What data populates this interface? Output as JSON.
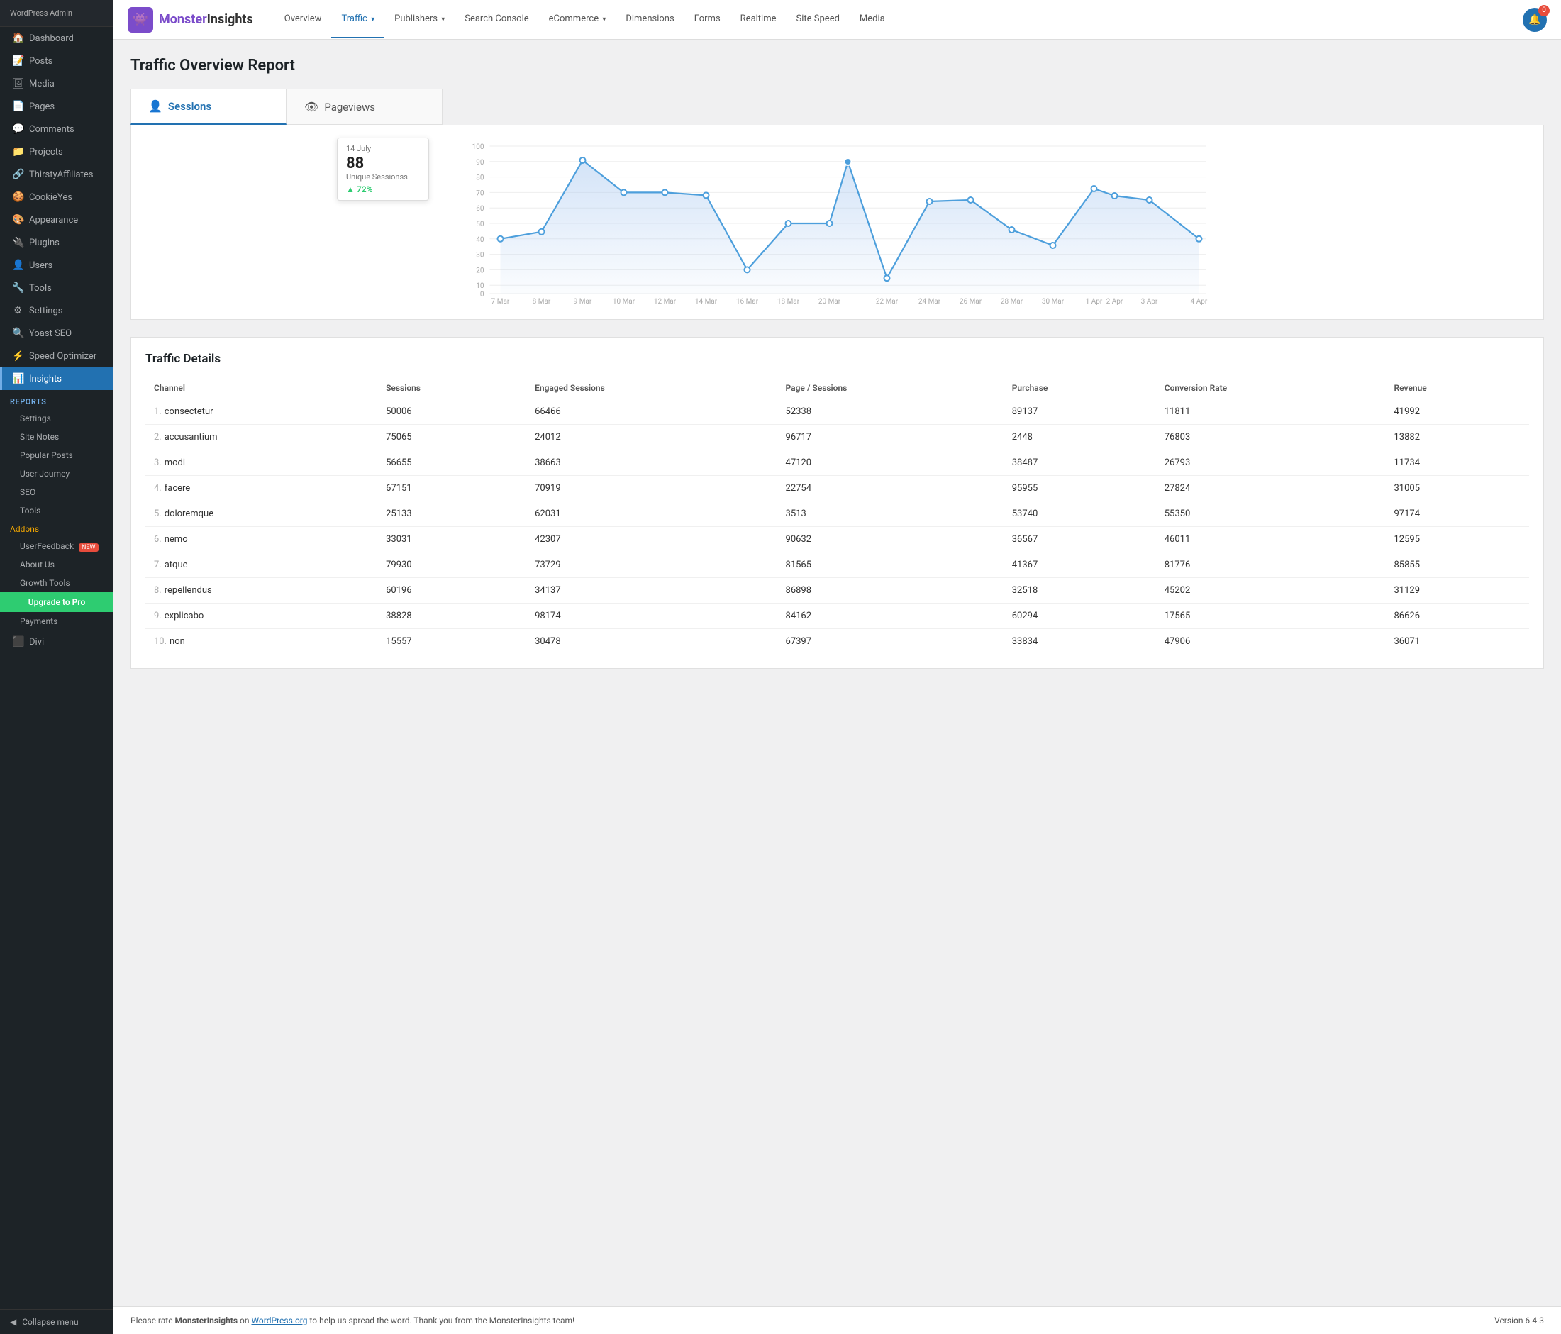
{
  "sidebar": {
    "menu_items": [
      {
        "id": "dashboard",
        "label": "Dashboard",
        "icon": "🏠"
      },
      {
        "id": "posts",
        "label": "Posts",
        "icon": "📝"
      },
      {
        "id": "media",
        "label": "Media",
        "icon": "🖼"
      },
      {
        "id": "pages",
        "label": "Pages",
        "icon": "📄"
      },
      {
        "id": "comments",
        "label": "Comments",
        "icon": "💬"
      },
      {
        "id": "projects",
        "label": "Projects",
        "icon": "📁"
      },
      {
        "id": "thirstyaffiliates",
        "label": "ThirstyAffiliates",
        "icon": "🔗"
      },
      {
        "id": "cookieyes",
        "label": "CookieYes",
        "icon": "🍪"
      },
      {
        "id": "appearance",
        "label": "Appearance",
        "icon": "🎨"
      },
      {
        "id": "plugins",
        "label": "Plugins",
        "icon": "🔌"
      },
      {
        "id": "users",
        "label": "Users",
        "icon": "👤"
      },
      {
        "id": "tools",
        "label": "Tools",
        "icon": "🔧"
      },
      {
        "id": "settings",
        "label": "Settings",
        "icon": "⚙"
      },
      {
        "id": "yoast",
        "label": "Yoast SEO",
        "icon": "🔍"
      },
      {
        "id": "speed",
        "label": "Speed Optimizer",
        "icon": "⚡"
      },
      {
        "id": "insights",
        "label": "Insights",
        "icon": "📊"
      }
    ],
    "reports_section": "Reports",
    "reports_items": [
      {
        "id": "settings",
        "label": "Settings"
      },
      {
        "id": "site-notes",
        "label": "Site Notes"
      },
      {
        "id": "popular-posts",
        "label": "Popular Posts"
      },
      {
        "id": "user-journey",
        "label": "User Journey"
      },
      {
        "id": "seo",
        "label": "SEO"
      },
      {
        "id": "tools",
        "label": "Tools"
      }
    ],
    "addons_label": "Addons",
    "addons_items": [
      {
        "id": "userfeedback",
        "label": "UserFeedback",
        "badge": "NEW"
      },
      {
        "id": "about-us",
        "label": "About Us"
      },
      {
        "id": "growth-tools",
        "label": "Growth Tools"
      }
    ],
    "upgrade_label": "Upgrade to Pro",
    "payments_label": "Payments",
    "divi_label": "Divi",
    "collapse_label": "Collapse menu"
  },
  "topnav": {
    "logo_text_monster": "Monster",
    "logo_text_insights": "Insights",
    "tabs": [
      {
        "id": "overview",
        "label": "Overview",
        "active": false
      },
      {
        "id": "traffic",
        "label": "Traffic",
        "active": true,
        "has_caret": true
      },
      {
        "id": "publishers",
        "label": "Publishers",
        "active": false,
        "has_caret": true
      },
      {
        "id": "search-console",
        "label": "Search Console",
        "active": false
      },
      {
        "id": "ecommerce",
        "label": "eCommerce",
        "active": false,
        "has_caret": true
      },
      {
        "id": "dimensions",
        "label": "Dimensions",
        "active": false
      },
      {
        "id": "forms",
        "label": "Forms",
        "active": false
      },
      {
        "id": "realtime",
        "label": "Realtime",
        "active": false
      },
      {
        "id": "site-speed",
        "label": "Site Speed",
        "active": false
      },
      {
        "id": "media",
        "label": "Media",
        "active": false
      }
    ],
    "notification_count": "0"
  },
  "report": {
    "title": "Traffic Overview Report",
    "metric_tabs": [
      {
        "id": "sessions",
        "label": "Sessions",
        "active": true,
        "icon": "👤"
      },
      {
        "id": "pageviews",
        "label": "Pageviews",
        "active": false,
        "icon": "👁"
      }
    ]
  },
  "chart": {
    "tooltip": {
      "date": "14 July",
      "value": "88",
      "label": "Unique Sessionss",
      "change": "72%"
    },
    "y_labels": [
      "100",
      "90",
      "80",
      "70",
      "60",
      "50",
      "40",
      "30",
      "20",
      "10",
      "0"
    ],
    "x_labels": [
      "7 Mar",
      "8 Mar",
      "9 Mar",
      "10 Mar",
      "12 Mar",
      "14 Mar",
      "16 Mar",
      "18 Mar",
      "20 Mar",
      "22 Mar",
      "24 Mar",
      "26 Mar",
      "28 Mar",
      "30 Mar",
      "1 Apr",
      "2 Apr",
      "3 Apr",
      "4 Apr"
    ]
  },
  "traffic_details": {
    "title": "Traffic Details",
    "columns": [
      "Channel",
      "Sessions",
      "Engaged Sessions",
      "Page / Sessions",
      "Purchase",
      "Conversion Rate",
      "Revenue"
    ],
    "rows": [
      {
        "num": "1.",
        "channel": "consectetur",
        "sessions": "50006",
        "engaged": "66466",
        "page_sessions": "52338",
        "purchase": "89137",
        "conversion": "11811",
        "revenue": "41992"
      },
      {
        "num": "2.",
        "channel": "accusantium",
        "sessions": "75065",
        "engaged": "24012",
        "page_sessions": "96717",
        "purchase": "2448",
        "conversion": "76803",
        "revenue": "13882"
      },
      {
        "num": "3.",
        "channel": "modi",
        "sessions": "56655",
        "engaged": "38663",
        "page_sessions": "47120",
        "purchase": "38487",
        "conversion": "26793",
        "revenue": "11734"
      },
      {
        "num": "4.",
        "channel": "facere",
        "sessions": "67151",
        "engaged": "70919",
        "page_sessions": "22754",
        "purchase": "95955",
        "conversion": "27824",
        "revenue": "31005"
      },
      {
        "num": "5.",
        "channel": "doloremque",
        "sessions": "25133",
        "engaged": "62031",
        "page_sessions": "3513",
        "purchase": "53740",
        "conversion": "55350",
        "revenue": "97174"
      },
      {
        "num": "6.",
        "channel": "nemo",
        "sessions": "33031",
        "engaged": "42307",
        "page_sessions": "90632",
        "purchase": "36567",
        "conversion": "46011",
        "revenue": "12595"
      },
      {
        "num": "7.",
        "channel": "atque",
        "sessions": "79930",
        "engaged": "73729",
        "page_sessions": "81565",
        "purchase": "41367",
        "conversion": "81776",
        "revenue": "85855"
      },
      {
        "num": "8.",
        "channel": "repellendus",
        "sessions": "60196",
        "engaged": "34137",
        "page_sessions": "86898",
        "purchase": "32518",
        "conversion": "45202",
        "revenue": "31129"
      },
      {
        "num": "9.",
        "channel": "explicabo",
        "sessions": "38828",
        "engaged": "98174",
        "page_sessions": "84162",
        "purchase": "60294",
        "conversion": "17565",
        "revenue": "86626"
      },
      {
        "num": "10.",
        "channel": "non",
        "sessions": "15557",
        "engaged": "30478",
        "page_sessions": "67397",
        "purchase": "33834",
        "conversion": "47906",
        "revenue": "36071"
      }
    ]
  },
  "footer": {
    "text_before": "Please rate ",
    "brand": "MonsterInsights",
    "text_middle": " on ",
    "link_text": "WordPress.org",
    "text_after": " to help us spread the word. Thank you from the MonsterInsights team!",
    "version": "Version 6.4.3"
  }
}
